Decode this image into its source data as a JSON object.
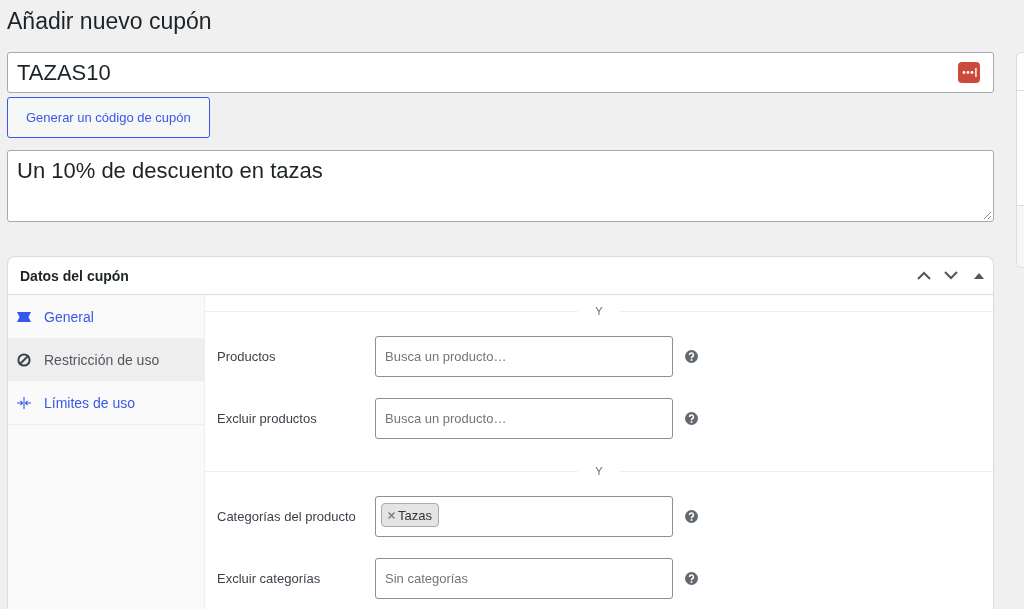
{
  "page_title": "Añadir nuevo cupón",
  "coupon_code": {
    "value": "TAZAS10"
  },
  "generate_button": {
    "label": "Generar un código de cupón"
  },
  "description": {
    "value": "Un 10% de descuento en tazas"
  },
  "coupon_data": {
    "title": "Datos del cupón",
    "tabs": [
      {
        "label": "General",
        "selected": false
      },
      {
        "label": "Restricción de uso",
        "selected": true
      },
      {
        "label": "Límites de uso",
        "selected": false
      }
    ],
    "sections": [
      {
        "separator": "Y",
        "fields": [
          {
            "kind": "text",
            "label": "Productos",
            "placeholder": "Busca un producto…"
          },
          {
            "kind": "text",
            "label": "Excluir productos",
            "placeholder": "Busca un producto…"
          }
        ]
      },
      {
        "separator": "Y",
        "fields": [
          {
            "kind": "tags",
            "label": "Categorías del producto",
            "tags": [
              {
                "label": "Tazas"
              }
            ]
          },
          {
            "kind": "text",
            "label": "Excluir categorías",
            "placeholder": "Sin categorías"
          }
        ]
      }
    ]
  }
}
